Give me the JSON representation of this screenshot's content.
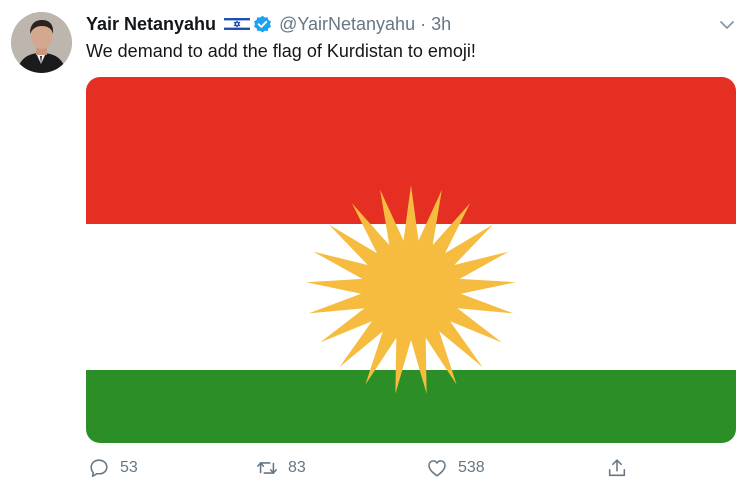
{
  "tweet": {
    "author": {
      "name": "Yair Netanyahu",
      "handle": "@YairNetanyahu",
      "verified": true,
      "country_flag_icon": "israel-flag-icon"
    },
    "separator": "·",
    "time": "3h",
    "text": "We demand to add the flag of Kurdistan to emoji!",
    "media": {
      "type": "image",
      "subject": "kurdistan-flag",
      "colors": {
        "red": "#e52f22",
        "white": "#ffffff",
        "green": "#2b8e27",
        "sun": "#f6bc3f"
      }
    },
    "actions": {
      "replies": "53",
      "retweets": "83",
      "likes": "538"
    },
    "icons": {
      "reply": "speech-bubble-icon",
      "retweet": "retweet-icon",
      "like": "heart-icon",
      "share": "share-icon",
      "menu": "chevron-down-icon"
    }
  }
}
